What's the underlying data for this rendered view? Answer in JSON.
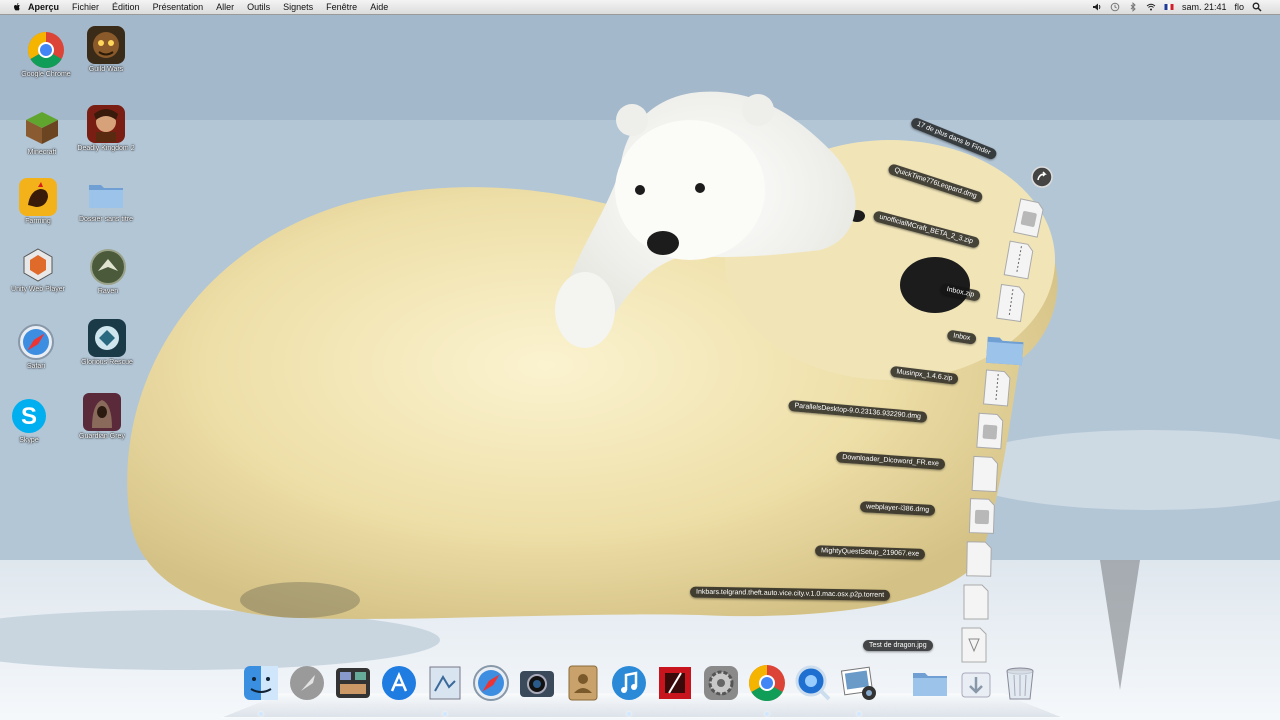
{
  "menubar": {
    "app_name": "Aperçu",
    "menus": [
      "Fichier",
      "Édition",
      "Présentation",
      "Aller",
      "Outils",
      "Signets",
      "Fenêtre",
      "Aide"
    ],
    "time": "sam. 21:41",
    "user": "flo"
  },
  "desktop_icons": [
    {
      "label": "Google Chrome",
      "icon": "chrome-icon"
    },
    {
      "label": "Guild Wars",
      "icon": "monkey-game-icon"
    },
    {
      "label": "Minecraft",
      "icon": "minecraft-icon"
    },
    {
      "label": "Deadly Kingdom 2",
      "icon": "warrior-game-icon"
    },
    {
      "label": "Farming",
      "icon": "rooster-game-icon"
    },
    {
      "label": "Dossier sans titre",
      "icon": "folder-icon"
    },
    {
      "label": "Unity Web Player",
      "icon": "unity-icon"
    },
    {
      "label": "Raven",
      "icon": "raven-icon"
    },
    {
      "label": "Safari",
      "icon": "safari-icon"
    },
    {
      "label": "Glorious Rescue",
      "icon": "crest-icon"
    },
    {
      "label": "Skype",
      "icon": "skype-icon"
    },
    {
      "label": "Guardian Grey",
      "icon": "hooded-warrior-icon"
    }
  ],
  "stack": {
    "more_label": "17 de plus dans le Finder",
    "items": [
      "QuickTime776Leopard.dmg",
      "unofficialMCraft_BETA_2_3.zip",
      "Inbox.zip",
      "Inbox",
      "Musinpx_1.4.6.zip",
      "ParallelsDesktop-9.0.23136.932290.dmg",
      "Downloader_Dicoword_FR.exe",
      "webplayer-i386.dmg",
      "MightyQuestSetup_219067.exe",
      "Inkbars.telgrand.theft.auto.vice.city.v.1.0.mac.osx.p2p.torrent",
      "Test de dragon.jpg"
    ]
  },
  "dock": {
    "items": [
      "finder-icon",
      "launchpad-icon",
      "mission-control-icon",
      "app-store-icon",
      "preview-icon",
      "safari-icon",
      "photo-booth-icon",
      "contacts-icon",
      "itunes-icon",
      "photo-booth-red-icon",
      "system-preferences-icon",
      "chrome-icon",
      "quicktime-icon",
      "iphoto-icon",
      "applications-folder-icon",
      "downloads-stack-icon",
      "trash-icon"
    ]
  },
  "colors": {
    "menubar_bg": "#e8e8e8",
    "stack_label_bg": "#1a1a1a",
    "folder_blue": "#8fb6e0"
  }
}
